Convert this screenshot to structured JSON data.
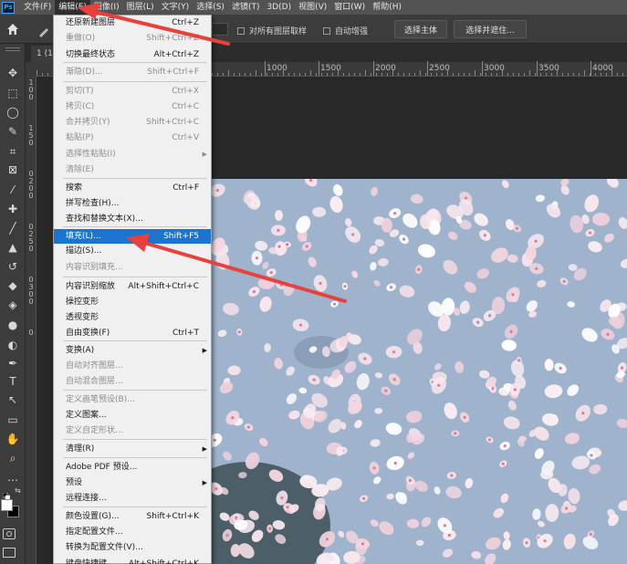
{
  "app": {
    "logo_text": "Ps"
  },
  "menubar": [
    {
      "label": "文件(F)"
    },
    {
      "label": "编辑(E)"
    },
    {
      "label": "图像(I)"
    },
    {
      "label": "图层(L)"
    },
    {
      "label": "文字(Y)"
    },
    {
      "label": "选择(S)"
    },
    {
      "label": "滤镜(T)"
    },
    {
      "label": "3D(D)"
    },
    {
      "label": "视图(V)"
    },
    {
      "label": "窗口(W)"
    },
    {
      "label": "帮助(H)"
    }
  ],
  "options_bar": {
    "sample_all_layers": "对所有图层取样",
    "auto_enhance": "自动增强",
    "select_subject": "选择主体",
    "select_and_mask": "选择并遮住..."
  },
  "document_tab": {
    "label": "1 (1"
  },
  "ruler": {
    "h_ticks": [
      "1000",
      "1500",
      "2000",
      "2500",
      "3000",
      "3500",
      "4000"
    ],
    "v_ticks": [
      "1",
      "0",
      "0",
      "1",
      "5",
      "0",
      "0",
      "2",
      "0",
      "0",
      "0",
      "2",
      "5",
      "0",
      "0",
      "3",
      "0",
      "0",
      "0"
    ]
  },
  "edit_menu": [
    {
      "label": "还原新建图层",
      "shortcut": "Ctrl+Z",
      "disabled": false
    },
    {
      "label": "重做(O)",
      "shortcut": "Shift+Ctrl+Z",
      "disabled": true
    },
    {
      "label": "切换最终状态",
      "shortcut": "Alt+Ctrl+Z",
      "disabled": false
    },
    {
      "label": "渐隐(D)...",
      "shortcut": "Shift+Ctrl+F",
      "disabled": true
    },
    {
      "label": "剪切(T)",
      "shortcut": "Ctrl+X",
      "disabled": true
    },
    {
      "label": "拷贝(C)",
      "shortcut": "Ctrl+C",
      "disabled": true
    },
    {
      "label": "合并拷贝(Y)",
      "shortcut": "Shift+Ctrl+C",
      "disabled": true
    },
    {
      "label": "粘贴(P)",
      "shortcut": "Ctrl+V",
      "disabled": true
    },
    {
      "label": "选择性粘贴(I)",
      "shortcut": "",
      "disabled": true,
      "submenu": true
    },
    {
      "label": "清除(E)",
      "shortcut": "",
      "disabled": true
    },
    {
      "label": "搜索",
      "shortcut": "Ctrl+F",
      "disabled": false
    },
    {
      "label": "拼写检查(H)...",
      "shortcut": "",
      "disabled": false
    },
    {
      "label": "查找和替换文本(X)...",
      "shortcut": "",
      "disabled": false
    },
    {
      "label": "填充(L)...",
      "shortcut": "Shift+F5",
      "disabled": false,
      "highlight": true
    },
    {
      "label": "描边(S)...",
      "shortcut": "",
      "disabled": false
    },
    {
      "label": "内容识别填充...",
      "shortcut": "",
      "disabled": true
    },
    {
      "label": "内容识别缩放",
      "shortcut": "Alt+Shift+Ctrl+C",
      "disabled": false
    },
    {
      "label": "操控变形",
      "shortcut": "",
      "disabled": false
    },
    {
      "label": "透视变形",
      "shortcut": "",
      "disabled": false
    },
    {
      "label": "自由变换(F)",
      "shortcut": "Ctrl+T",
      "disabled": false
    },
    {
      "label": "变换(A)",
      "shortcut": "",
      "disabled": false,
      "submenu": true
    },
    {
      "label": "自动对齐图层...",
      "shortcut": "",
      "disabled": true
    },
    {
      "label": "自动混合图层...",
      "shortcut": "",
      "disabled": true
    },
    {
      "label": "定义画笔预设(B)...",
      "shortcut": "",
      "disabled": true
    },
    {
      "label": "定义图案...",
      "shortcut": "",
      "disabled": false
    },
    {
      "label": "定义自定形状...",
      "shortcut": "",
      "disabled": true
    },
    {
      "label": "清理(R)",
      "shortcut": "",
      "disabled": false,
      "submenu": true
    },
    {
      "label": "Adobe PDF 预设...",
      "shortcut": "",
      "disabled": false
    },
    {
      "label": "预设",
      "shortcut": "",
      "disabled": false,
      "submenu": true
    },
    {
      "label": "远程连接...",
      "shortcut": "",
      "disabled": false
    },
    {
      "label": "颜色设置(G)...",
      "shortcut": "Shift+Ctrl+K",
      "disabled": false
    },
    {
      "label": "指定配置文件...",
      "shortcut": "",
      "disabled": false
    },
    {
      "label": "转换为配置文件(V)...",
      "shortcut": "",
      "disabled": false
    },
    {
      "label": "键盘快捷键...",
      "shortcut": "Alt+Shift+Ctrl+K",
      "disabled": false
    }
  ],
  "tools": [
    {
      "icon": "move-icon",
      "glyph": "✥"
    },
    {
      "icon": "marquee-icon",
      "glyph": "⬚"
    },
    {
      "icon": "lasso-icon",
      "glyph": "◯"
    },
    {
      "icon": "quick-select-icon",
      "glyph": "✎"
    },
    {
      "icon": "crop-icon",
      "glyph": "⌗"
    },
    {
      "icon": "frame-icon",
      "glyph": "⊠"
    },
    {
      "icon": "eyedropper-icon",
      "glyph": "⁄"
    },
    {
      "icon": "healing-icon",
      "glyph": "✚"
    },
    {
      "icon": "brush-icon",
      "glyph": "╱"
    },
    {
      "icon": "stamp-icon",
      "glyph": "▲"
    },
    {
      "icon": "history-brush-icon",
      "glyph": "↺"
    },
    {
      "icon": "eraser-icon",
      "glyph": "◆"
    },
    {
      "icon": "gradient-icon",
      "glyph": "◈"
    },
    {
      "icon": "blur-icon",
      "glyph": "●"
    },
    {
      "icon": "dodge-icon",
      "glyph": "◐"
    },
    {
      "icon": "pen-icon",
      "glyph": "✒"
    },
    {
      "icon": "type-icon",
      "glyph": "T"
    },
    {
      "icon": "path-select-icon",
      "glyph": "↖"
    },
    {
      "icon": "rectangle-icon",
      "glyph": "▭"
    },
    {
      "icon": "hand-icon",
      "glyph": "✋"
    },
    {
      "icon": "zoom-icon",
      "glyph": "⌕"
    },
    {
      "icon": "more-icon",
      "glyph": "…"
    }
  ]
}
